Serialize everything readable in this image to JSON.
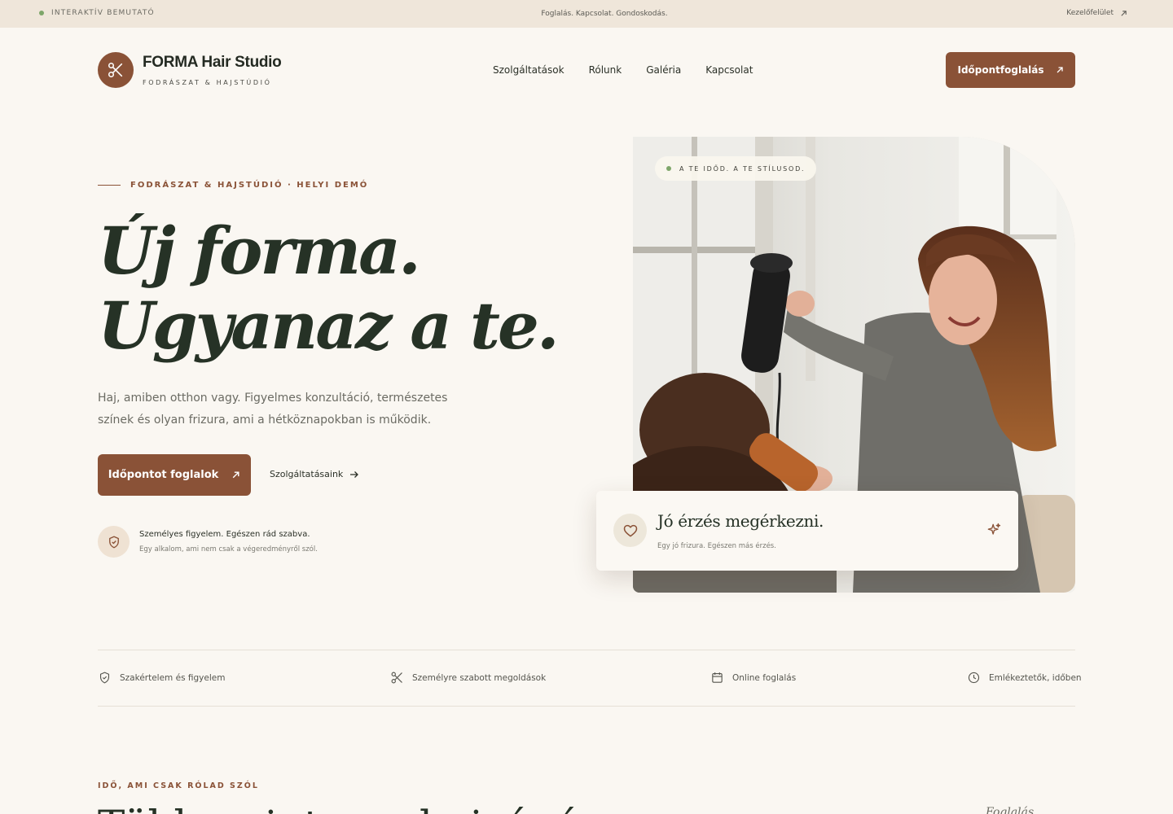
{
  "topbar": {
    "demo_label": "INTERAKTÍV BEMUTATÓ",
    "tagline": "Foglalás. Kapcsolat. Gondoskodás.",
    "admin_link": "Kezelőfelület"
  },
  "header": {
    "brand_name": "FORMA Hair Studio",
    "brand_sub": "FODRÁSZAT & HAJSTÚDIÓ",
    "nav": [
      "Szolgáltatások",
      "Rólunk",
      "Galéria",
      "Kapcsolat"
    ],
    "cta": "Időpontfoglalás"
  },
  "hero": {
    "eyebrow": "FODRÁSZAT & HAJSTÚDIÓ · HELYI DEMÓ",
    "headline_line1": "Új forma.",
    "headline_line2": "Ugyanaz a te.",
    "lead": "Haj, amiben otthon vagy. Figyelmes konzultáció, természetes színek és olyan frizura, ami a hétköznapokban is működik.",
    "primary_button": "Időpontot foglalok",
    "secondary_link": "Szolgáltatásaink",
    "note_title": "Személyes figyelem. Egészen rád szabva.",
    "note_sub": "Egy alkalom, ami nem csak a végeredményről szól."
  },
  "photo": {
    "pill": "A TE IDŐD. A TE STÍLUSOD.",
    "card_title": "Jó érzés megérkezni.",
    "card_sub": "Egy jó frizura. Egészen más érzés."
  },
  "features": [
    {
      "icon": "shield-check-icon",
      "label": "Szakértelem és figyelem"
    },
    {
      "icon": "scissors-icon",
      "label": "Személyre szabott megoldások"
    },
    {
      "icon": "calendar-icon",
      "label": "Online foglalás"
    },
    {
      "icon": "clock-icon",
      "label": "Emlékeztetők, időben"
    }
  ],
  "section": {
    "eyebrow": "IDŐ, AMI CSAK RÓLAD SZÓL",
    "heading": "Több, mint egy hajvágás",
    "side_text": "Foglalás"
  },
  "colors": {
    "accent": "#8a5237",
    "background": "#faf7f2",
    "topbar": "#efe6da",
    "ink": "#263226",
    "status_dot": "#7ea66a"
  }
}
